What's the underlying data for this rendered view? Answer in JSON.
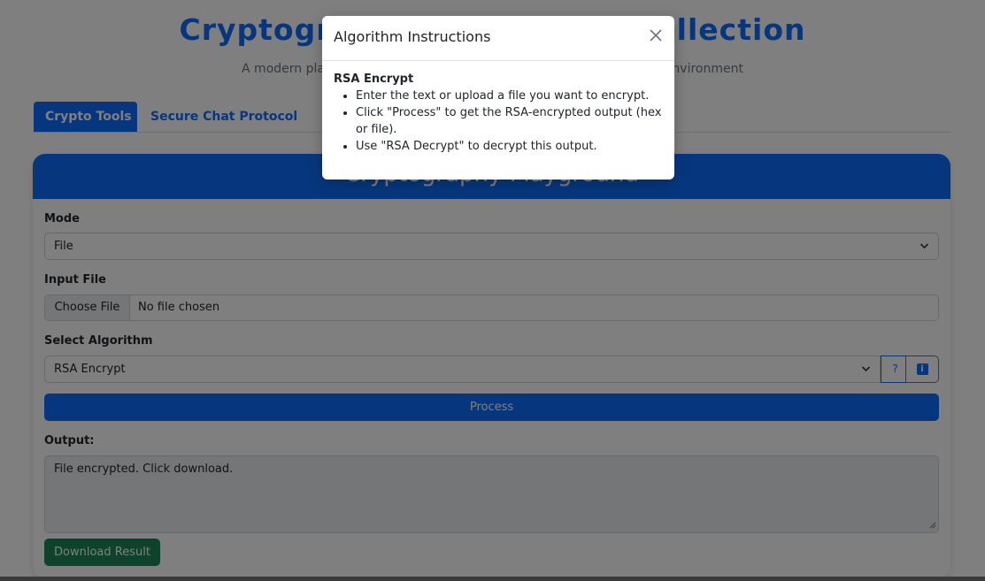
{
  "hero": {
    "title": "Cryptography Playground Collection",
    "subtitle": "A modern playground for cryptographic algorithms and secure chat environment"
  },
  "tabs": [
    {
      "label": "Crypto Tools",
      "active": true
    },
    {
      "label": "Secure Chat Protocol",
      "active": false
    }
  ],
  "card": {
    "header_title": "Cryptography Playground"
  },
  "form": {
    "mode_label": "Mode",
    "mode_value": "File",
    "input_file_label": "Input File",
    "choose_file_label": "Choose File",
    "file_status": "No file chosen",
    "algorithm_label": "Select Algorithm",
    "algorithm_value": "RSA Encrypt",
    "help_button_label": "?",
    "info_button_label": "i",
    "process_label": "Process",
    "output_label": "Output:",
    "output_value": "File encrypted. Click download.",
    "download_label": "Download Result"
  },
  "modal": {
    "title": "Algorithm Instructions",
    "close_symbol": "×",
    "heading": "RSA Encrypt",
    "items": [
      "Enter the text or upload a file you want to encrypt.",
      "Click \"Process\" to get the RSA-encrypted output (hex or file).",
      "Use \"RSA Decrypt\" to decrypt this output."
    ]
  },
  "colors": {
    "primary": "#0d6efd",
    "success": "#198754",
    "backdrop": "rgba(0,0,0,0.5)"
  },
  "icons": {
    "select_chevron": "chevron-down-icon",
    "close": "close-icon",
    "help": "help-icon",
    "info": "info-icon"
  }
}
